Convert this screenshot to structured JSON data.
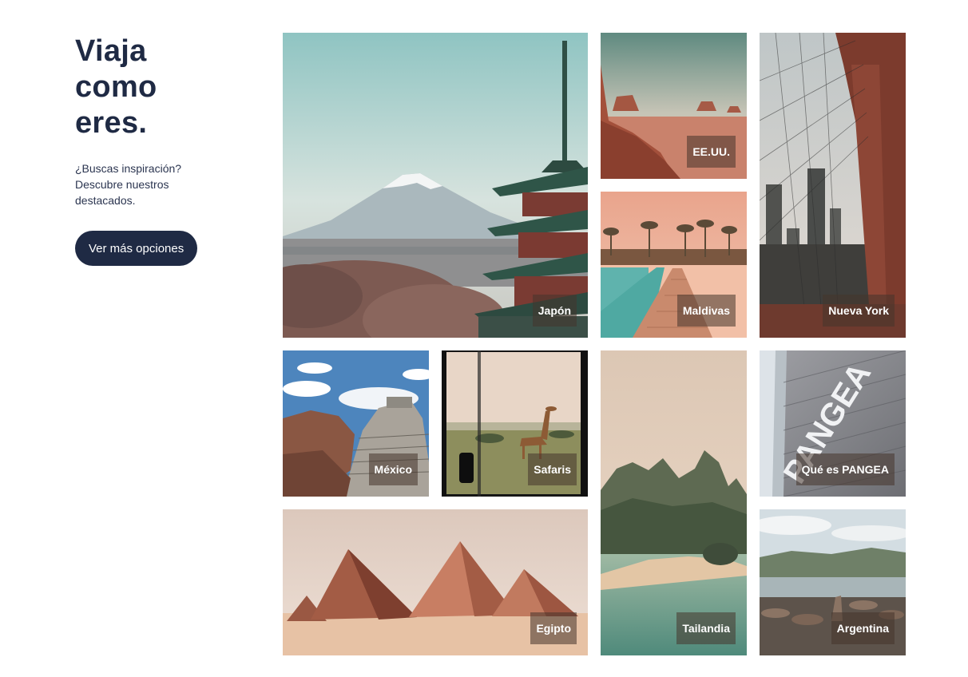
{
  "intro": {
    "title_lines": [
      "Viaja",
      "como",
      "eres."
    ],
    "subtitle": "¿Buscas inspiración? Descubre nuestros destacados.",
    "cta_label": "Ver más opciones"
  },
  "destinations": {
    "japon": "Japón",
    "eeuu": "EE.UU.",
    "nueva_york": "Nueva York",
    "maldivas": "Maldivas",
    "mexico": "México",
    "safaris": "Safaris",
    "tailandia": "Tailandia",
    "pangea": "Qué es PANGEA",
    "egipto": "Egipto",
    "argentina": "Argentina"
  },
  "sign_text": "PANGEA",
  "colors": {
    "primary": "#1f2a44",
    "tag_bg": "rgba(70,52,44,0.55)",
    "background": "#ffffff"
  }
}
